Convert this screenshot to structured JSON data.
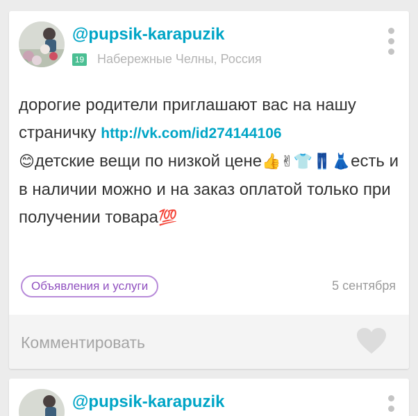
{
  "colors": {
    "accent": "#00a5c6",
    "age_badge": "#4bbf93",
    "tag_border": "#b78ad9",
    "tag_text": "#8f4fbf"
  },
  "posts": [
    {
      "username": "@pupsik-karapuzik",
      "age": "19",
      "location": "Набережные Челны, Россия",
      "text_1": "дорогие родители приглашают вас на нашу страничку ",
      "link": "http://vk.com/id274144106",
      "emoji_smile": "😊",
      "text_2": "детские вещи по низкой цене",
      "emoji_row": "👍✌👕👖👗",
      "text_3": "есть и в наличии можно и на заказ оплатой только при получении товара",
      "emoji_100": "💯",
      "tag": "Объявления и услуги",
      "date": "5 сентября",
      "comment_placeholder": "Комментировать",
      "icons": [
        "more-vertical-icon",
        "heart-icon"
      ]
    },
    {
      "username": "@pupsik-karapuzik"
    }
  ]
}
